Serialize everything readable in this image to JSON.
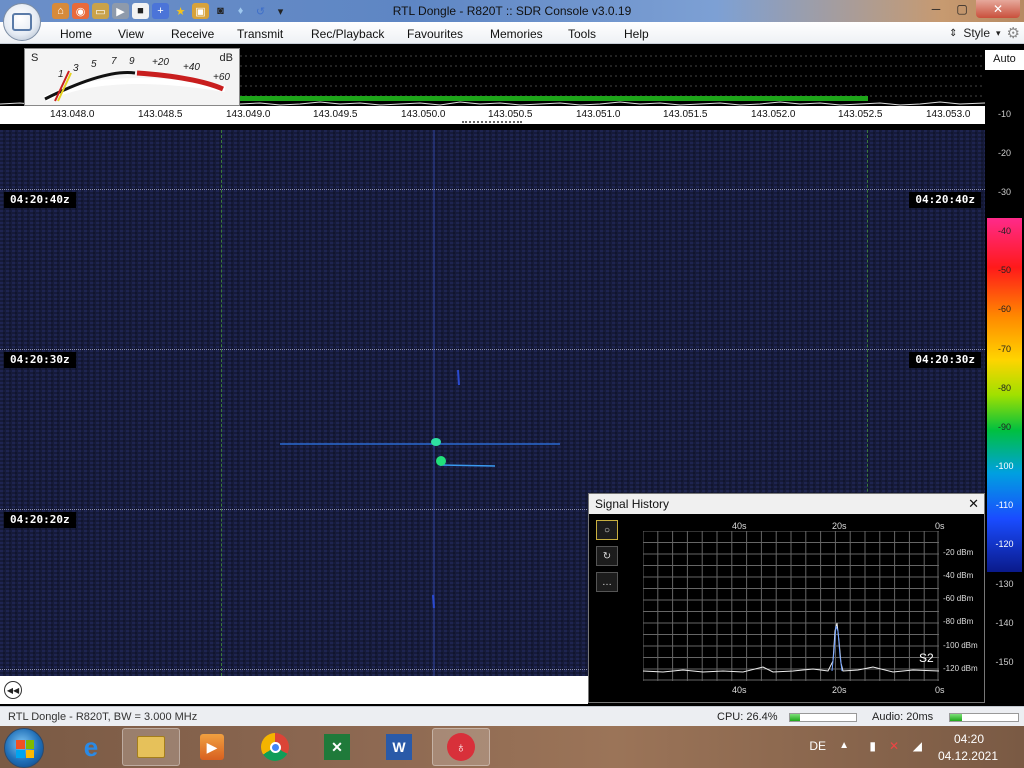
{
  "window": {
    "title": "RTL Dongle - R820T :: SDR Console v3.0.19",
    "buttons": {
      "minimize": "─",
      "maximize": "▢",
      "close": "✕"
    }
  },
  "quick_access": [
    "home-icon",
    "lifebuoy-icon",
    "folder-icon",
    "play-icon",
    "stop-icon",
    "add-icon",
    "star-icon",
    "lock-icon",
    "camera-icon",
    "drop-icon",
    "undo-icon",
    "dropdown-icon"
  ],
  "menu": {
    "items": [
      "Home",
      "View",
      "Receive",
      "Transmit",
      "Rec/Playback",
      "Favourites",
      "Memories",
      "Tools",
      "Help"
    ],
    "style_label": "Style"
  },
  "smeter": {
    "s_label": "S",
    "db_label": "dB",
    "scale": [
      "1",
      "3",
      "5",
      "7",
      "9",
      "+20",
      "+40",
      "+60"
    ]
  },
  "spectrum": {
    "frequencies": [
      "143.048.0",
      "143.048.5",
      "143.049.0",
      "143.049.5",
      "143.050.0",
      "143.050.5",
      "143.051.0",
      "143.051.5",
      "143.052.0",
      "143.052.5",
      "143.053.0"
    ]
  },
  "scale_panel": {
    "auto_label": "Auto",
    "db_ticks": [
      "-10",
      "-20",
      "-30",
      "-40",
      "-50",
      "-60",
      "-70",
      "-80",
      "-90",
      "-100",
      "-110",
      "-120",
      "-130",
      "-140",
      "-150"
    ]
  },
  "waterfall": {
    "timestamps": [
      "04:20:40z",
      "04:20:30z",
      "04:20:20z"
    ]
  },
  "signal_history": {
    "title": "Signal History",
    "close": "✕",
    "time_labels": [
      "40s",
      "20s",
      "0s"
    ],
    "db_labels": [
      "-20 dBm",
      "-40 dBm",
      "-60 dBm",
      "-80 dBm",
      "-100 dBm",
      "-120 dBm"
    ],
    "s_reading": "S2",
    "buttons": [
      "record-icon",
      "refresh-icon",
      "more-icon"
    ],
    "more_label": "…"
  },
  "statusbar": {
    "device": "RTL Dongle - R820T, BW = 3.000 MHz",
    "cpu": "CPU: 26.4%",
    "cpu_fill": 0.15,
    "audio": "Audio: 20ms",
    "audio_fill": 0.18
  },
  "taskbar": {
    "apps": [
      "internet-explorer-icon",
      "file-explorer-icon",
      "media-player-icon",
      "chrome-icon",
      "excel-icon",
      "word-icon",
      "sdr-console-icon"
    ],
    "language": "DE",
    "time": "04:20",
    "date": "04.12.2021"
  },
  "colors": {
    "waterfall_bg": "#151a38",
    "signal": "#22e07a",
    "spectrum_fill": "#1ea51a",
    "window_close": "#c9503c"
  }
}
